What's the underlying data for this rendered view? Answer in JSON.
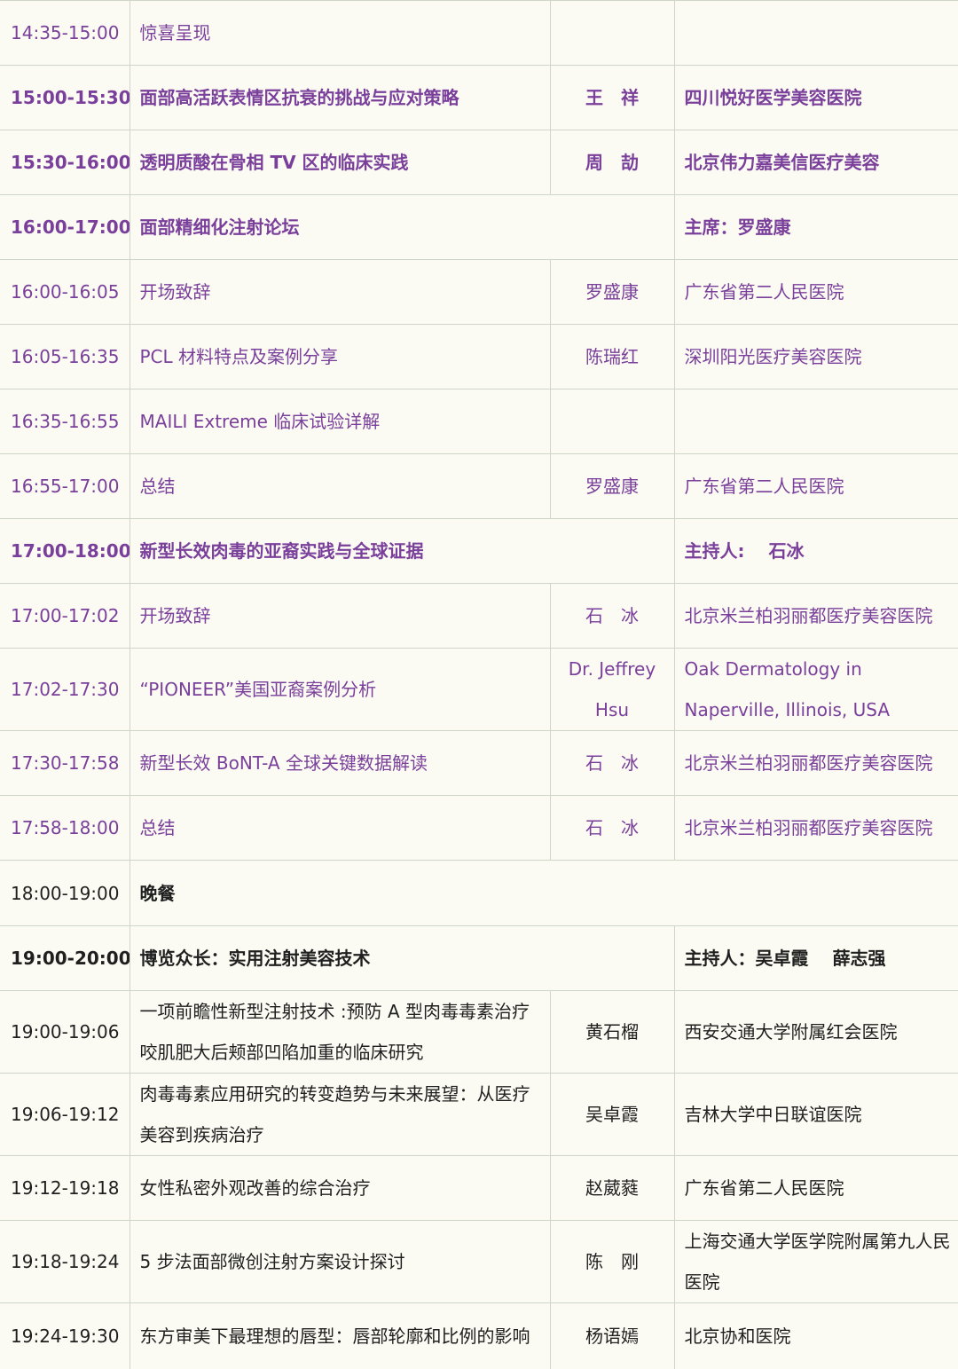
{
  "rows": [
    {
      "time": "14:35-15:00",
      "topic": "惊喜呈现",
      "speaker": "",
      "org": "",
      "bold": false,
      "dark": false
    },
    {
      "time": "15:00-15:30",
      "topic": "面部高活跃表情区抗衰的挑战与应对策略",
      "speaker": "王　祥",
      "org": "四川悦好医学美容医院",
      "bold": true,
      "dark": false
    },
    {
      "time": "15:30-16:00",
      "topic": "透明质酸在骨相 TV 区的临床实践",
      "speaker": "周　劼",
      "org": "北京伟力嘉美信医疗美容",
      "bold": true,
      "dark": false
    },
    {
      "time": "16:00-17:00",
      "topic": "面部精细化注射论坛",
      "speaker": null,
      "org": "主席：罗盛康",
      "bold": true,
      "dark": false
    },
    {
      "time": "16:00-16:05",
      "topic": "开场致辞",
      "speaker": "罗盛康",
      "org": "广东省第二人民医院",
      "bold": false,
      "dark": false
    },
    {
      "time": "16:05-16:35",
      "topic": "PCL 材料特点及案例分享",
      "speaker": "陈瑞红",
      "org": "深圳阳光医疗美容医院",
      "bold": false,
      "dark": false
    },
    {
      "time": "16:35-16:55",
      "topic": "MAILI Extreme  临床试验详解",
      "speaker": "",
      "org": "",
      "bold": false,
      "dark": false
    },
    {
      "time": "16:55-17:00",
      "topic": "总结",
      "speaker": "罗盛康",
      "org": "广东省第二人民医院",
      "bold": false,
      "dark": false
    },
    {
      "time": "17:00-18:00",
      "topic": "新型长效肉毒的亚裔实践与全球证据",
      "speaker": null,
      "org": "主持人:　 石冰",
      "bold": true,
      "dark": false
    },
    {
      "time": "17:00-17:02",
      "topic": "开场致辞",
      "speaker": "石　冰",
      "org": "北京米兰柏羽丽都医疗美容医院",
      "bold": false,
      "dark": false
    },
    {
      "time": "17:02-17:30",
      "topic": " “PIONEER”美国亚裔案例分析",
      "speaker": "Dr. Jeffrey Hsu",
      "org": "Oak Dermatology in Naperville, Illinois, USA",
      "bold": false,
      "dark": false,
      "tall": true
    },
    {
      "time": "17:30-17:58",
      "topic": "新型长效 BoNT-A 全球关键数据解读",
      "speaker": "石　冰",
      "org": "北京米兰柏羽丽都医疗美容医院",
      "bold": false,
      "dark": false
    },
    {
      "time": "17:58-18:00",
      "topic": "总结",
      "speaker": "石　冰",
      "org": "北京米兰柏羽丽都医疗美容医院",
      "bold": false,
      "dark": false
    },
    {
      "time": "18:00-19:00",
      "topic": "晚餐",
      "speaker": null,
      "org": null,
      "bold": false,
      "dark": true,
      "topicBold": true
    },
    {
      "time": "19:00-20:00",
      "topic": "博览众长：实用注射美容技术",
      "speaker": null,
      "org": "主持人：吴卓霞　  薛志强",
      "bold": true,
      "dark": true
    },
    {
      "time": "19:00-19:06",
      "topic": "一项前瞻性新型注射技术 :预防 A 型肉毒毒素治疗咬肌肥大后颊部凹陷加重的临床研究",
      "speaker": "黄石榴",
      "org": "西安交通大学附属红会医院",
      "bold": false,
      "dark": true,
      "tall": true
    },
    {
      "time": "19:06-19:12",
      "topic": "肉毒毒素应用研究的转变趋势与未来展望：从医疗美容到疾病治疗",
      "speaker": "吴卓霞",
      "org": "吉林大学中日联谊医院",
      "bold": false,
      "dark": true,
      "tall": true
    },
    {
      "time": "19:12-19:18",
      "topic": "女性私密外观改善的综合治疗",
      "speaker": "赵葳蕤",
      "org": "广东省第二人民医院",
      "bold": false,
      "dark": true
    },
    {
      "time": "19:18-19:24",
      "topic": "5 步法面部微创注射方案设计探讨",
      "speaker": "陈　刚",
      "org": "上海交通大学医学院附属第九人民医院",
      "bold": false,
      "dark": true,
      "tall": true
    },
    {
      "time": "19:24-19:30",
      "topic": "东方审美下最理想的唇型：唇部轮廓和比例的影响",
      "speaker": "杨语嫣",
      "org": "北京协和医院",
      "bold": false,
      "dark": true
    }
  ]
}
